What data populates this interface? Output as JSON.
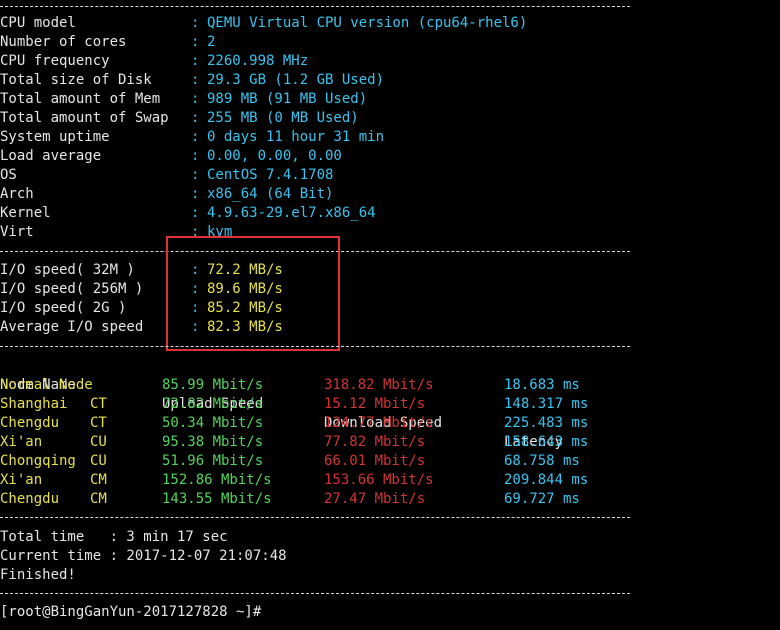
{
  "sysinfo": [
    {
      "label": "CPU model",
      "value": "QEMU Virtual CPU version (cpu64-rhel6)"
    },
    {
      "label": "Number of cores",
      "value": "2"
    },
    {
      "label": "CPU frequency",
      "value": "2260.998 MHz"
    },
    {
      "label": "Total size of Disk",
      "value": "29.3 GB (1.2 GB Used)"
    },
    {
      "label": "Total amount of Mem",
      "value": "989 MB (91 MB Used)"
    },
    {
      "label": "Total amount of Swap",
      "value": "255 MB (0 MB Used)"
    },
    {
      "label": "System uptime",
      "value": "0 days 11 hour 31 min"
    },
    {
      "label": "Load average",
      "value": "0.00, 0.00, 0.00"
    },
    {
      "label": "OS",
      "value": "CentOS 7.4.1708"
    },
    {
      "label": "Arch",
      "value": "x86_64 (64 Bit)"
    },
    {
      "label": "Kernel",
      "value": "4.9.63-29.el7.x86_64"
    },
    {
      "label": "Virt",
      "value": "kvm"
    }
  ],
  "io": [
    {
      "label": "I/O speed( 32M )",
      "value": "72.2 MB/s"
    },
    {
      "label": "I/O speed( 256M )",
      "value": "89.6 MB/s"
    },
    {
      "label": "I/O speed( 2G )",
      "value": "85.2 MB/s"
    },
    {
      "label": "Average I/O speed",
      "value": "82.3 MB/s"
    }
  ],
  "colon": ":",
  "speed_headers": {
    "node": "Node Name",
    "upload": "Upload Speed",
    "download": "Download Speed",
    "latency": "Latency"
  },
  "speed_rows": [
    {
      "node": "Normal Node",
      "isp": "",
      "upload": "85.99 Mbit/s",
      "download": "318.82 Mbit/s",
      "latency": "18.683 ms"
    },
    {
      "node": "Shanghai",
      "isp": "CT",
      "upload": "72.82 Mbit/s",
      "download": "15.12 Mbit/s",
      "latency": "148.317 ms"
    },
    {
      "node": "Chengdu",
      "isp": "CT",
      "upload": "50.34 Mbit/s",
      "download": "124.77 Mbit/s",
      "latency": "225.483 ms"
    },
    {
      "node": "Xi'an",
      "isp": "CU",
      "upload": "95.38 Mbit/s",
      "download": "77.82 Mbit/s",
      "latency": "158.643 ms"
    },
    {
      "node": "Chongqing",
      "isp": "CU",
      "upload": "51.96 Mbit/s",
      "download": "66.01 Mbit/s",
      "latency": "68.758 ms"
    },
    {
      "node": "Xi'an",
      "isp": "CM",
      "upload": "152.86 Mbit/s",
      "download": "153.66 Mbit/s",
      "latency": "209.844 ms"
    },
    {
      "node": "Chengdu",
      "isp": "CM",
      "upload": "143.55 Mbit/s",
      "download": "27.47 Mbit/s",
      "latency": "69.727 ms"
    }
  ],
  "summary": {
    "total_time": "Total time   : 3 min 17 sec",
    "current_time": "Current time : 2017-12-07 21:07:48",
    "finished": "Finished!"
  },
  "prompt": "[root@BingGanYun-2017127828 ~]#",
  "colors": {
    "label": "#e6e6e6",
    "info": "#37c4f0",
    "io": "#e6e04a",
    "upload": "#52d35b",
    "download": "#d23434",
    "latency": "#37c4f0",
    "highlight": "#e03232"
  }
}
